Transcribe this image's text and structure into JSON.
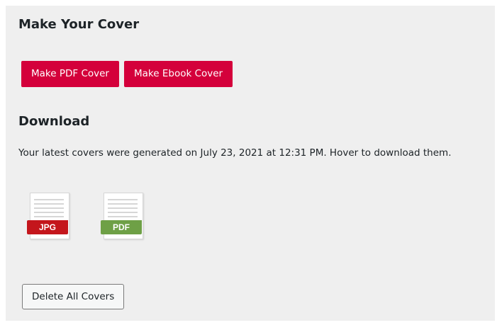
{
  "make_section": {
    "title": "Make Your Cover",
    "pdf_button_label": "Make PDF Cover",
    "ebook_button_label": "Make Ebook Cover"
  },
  "download_section": {
    "title": "Download",
    "info_text": "Your latest covers were generated on July 23, 2021 at 12:31 PM. Hover to download them.",
    "files": [
      {
        "label": "JPG",
        "icon": "jpg-file-icon",
        "color": "#c4161c"
      },
      {
        "label": "PDF",
        "icon": "pdf-file-icon",
        "color": "#6ea046"
      }
    ],
    "delete_button_label": "Delete All Covers"
  },
  "colors": {
    "primary_button": "#d4003b",
    "panel_background": "#efefef"
  }
}
